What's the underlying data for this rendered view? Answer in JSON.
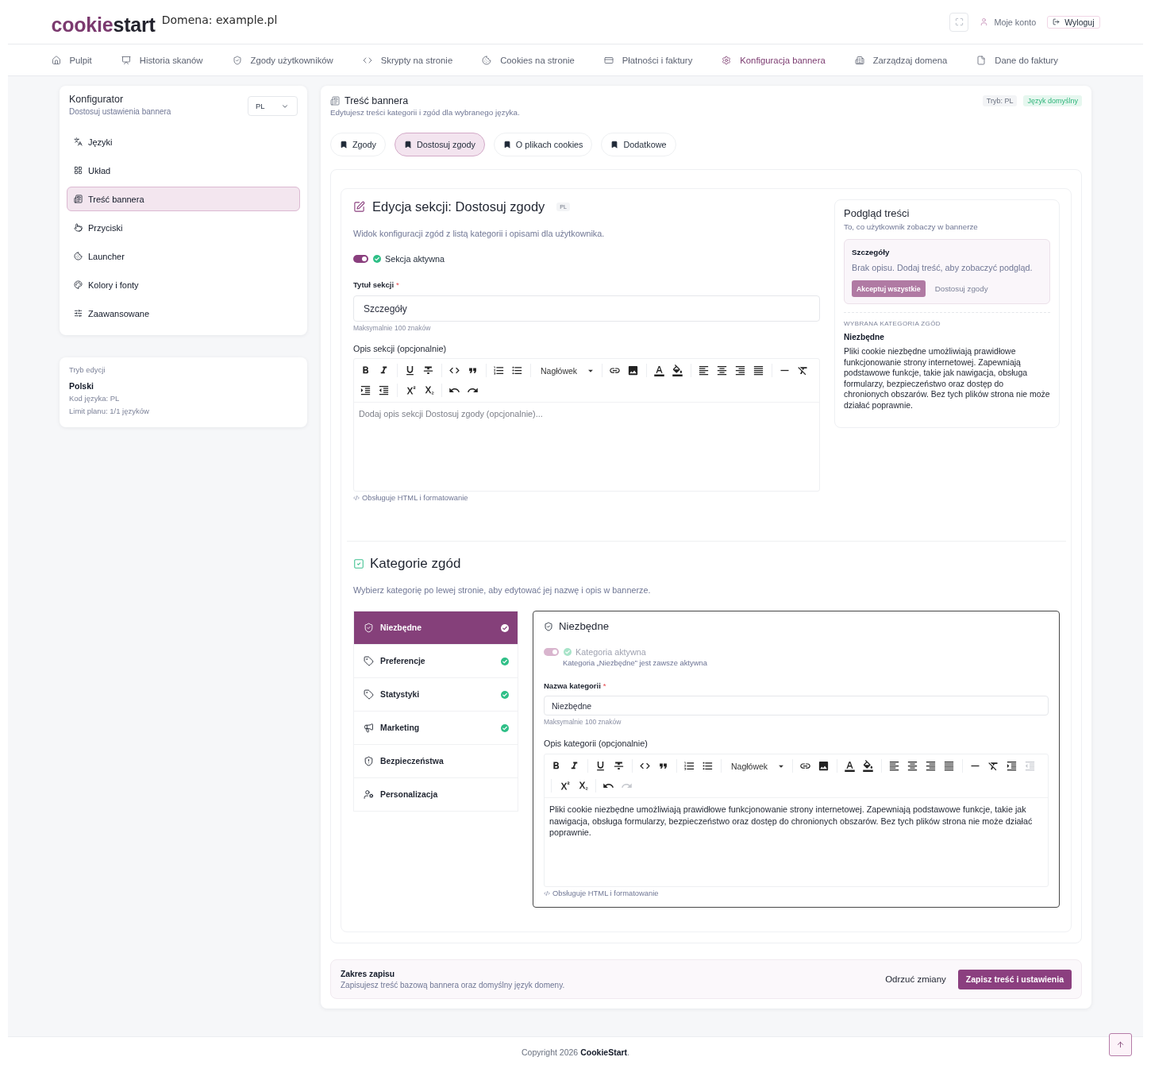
{
  "header": {
    "logo": {
      "brand": "cookie",
      "suffix": "start"
    },
    "domain": "Domena: example.pl",
    "account_link": "Moje konto",
    "logout_button": "Wyloguj"
  },
  "nav": [
    {
      "label": "Pulpit",
      "selected": false
    },
    {
      "label": "Historia skanów",
      "selected": false
    },
    {
      "label": "Zgody użytkowników",
      "selected": false
    },
    {
      "label": "Skrypty na stronie",
      "selected": false
    },
    {
      "label": "Cookies na stronie",
      "selected": false
    },
    {
      "label": "Płatności i faktury",
      "selected": false
    },
    {
      "label": "Konfiguracja bannera",
      "selected": true
    },
    {
      "label": "Zarządzaj domena",
      "selected": false
    },
    {
      "label": "Dane do faktury",
      "selected": false
    }
  ],
  "sidebar": {
    "title": "Konfigurator",
    "subtitle": "Dostosuj ustawienia bannera",
    "language_select": "PL",
    "items": [
      {
        "label": "Języki",
        "selected": false
      },
      {
        "label": "Układ",
        "selected": false
      },
      {
        "label": "Treść bannera",
        "selected": true
      },
      {
        "label": "Przyciski",
        "selected": false
      },
      {
        "label": "Launcher",
        "selected": false
      },
      {
        "label": "Kolory i fonty",
        "selected": false
      },
      {
        "label": "Zaawansowane",
        "selected": false
      }
    ]
  },
  "edit_mode": {
    "label": "Tryb edycji",
    "language": "Polski",
    "language_code": "Kod języka: PL",
    "plan_limit": "Limit planu: 1/1 języków"
  },
  "panel": {
    "title": "Treść bannera",
    "subtitle": "Edytujesz treści kategorii i zgód dla wybranego języka.",
    "badges": [
      {
        "label": "Tryb: PL",
        "kind": "neutral"
      },
      {
        "label": "Język domyślny",
        "kind": "success"
      }
    ],
    "tabs": [
      {
        "label": "Zgody",
        "selected": false
      },
      {
        "label": "Dostosuj zgody",
        "selected": true
      },
      {
        "label": "O plikach cookies",
        "selected": false
      },
      {
        "label": "Dodatkowe",
        "selected": false
      }
    ]
  },
  "section_editor": {
    "title": "Edycja sekcji: Dostosuj zgody",
    "language_badge": "PL",
    "description": "Widok konfiguracji zgód z listą kategorii i opisami dla użytkownika.",
    "active_toggle": {
      "label": "Sekcja aktywna",
      "on": true
    },
    "title_field": {
      "label": "Tytuł sekcji",
      "required_mark": "*",
      "value": "Szczegóły",
      "help": "Maksymalnie 100 znaków"
    },
    "description_field": {
      "label": "Opis sekcji (opcjonalnie)",
      "editor": {
        "heading_select": "Nagłówek",
        "outdent": {
          "disabled": false
        },
        "redo": {
          "disabled": false
        },
        "placeholder": "Dodaj opis sekcji Dostosuj zgody (opcjonalnie)..."
      },
      "note": "Obsługuje HTML i formatowanie"
    }
  },
  "preview": {
    "title": "Podgląd treści",
    "subtitle": "To, co użytkownik zobaczy w bannerze",
    "banner": {
      "title": "Szczegóły",
      "text": "Brak opisu. Dodaj treść, aby zobaczyć podgląd.",
      "accept_button": "Akceptuj wszystkie",
      "customize_button": "Dostosuj zgody"
    },
    "selected_category": {
      "heading": "WYBRANA KATEGORIA ZGÓD",
      "name": "Niezbędne",
      "description": "Pliki cookie niezbędne umożliwiają prawidłowe funkcjonowanie strony internetowej. Zapewniają podstawowe funkcje, takie jak nawigacja, obsługa formularzy, bezpieczeństwo oraz dostęp do chronionych obszarów. Bez tych plików strona nie może działać poprawnie."
    }
  },
  "categories": {
    "title": "Kategorie zgód",
    "subtitle": "Wybierz kategorię po lewej stronie, aby edytować jej nazwę i opis w bannerze.",
    "items": [
      {
        "label": "Niezbędne",
        "selected": true,
        "active": true
      },
      {
        "label": "Preferencje",
        "selected": false,
        "active": true
      },
      {
        "label": "Statystyki",
        "selected": false,
        "active": true
      },
      {
        "label": "Marketing",
        "selected": false,
        "active": true
      },
      {
        "label": "Bezpieczeństwa",
        "selected": false,
        "active": false
      },
      {
        "label": "Personalizacja",
        "selected": false,
        "active": false
      }
    ],
    "editor": {
      "title": "Niezbędne",
      "active_toggle": {
        "label": "Kategoria aktywna",
        "on": true,
        "disabled": true
      },
      "locked_note": "Kategoria „Niezbędne” jest zawsze aktywna",
      "name_field": {
        "label": "Nazwa kategorii",
        "required_mark": "*",
        "value": "Niezbędne",
        "help": "Maksymalnie 100 znaków"
      },
      "description_field": {
        "label": "Opis kategorii (opcjonalnie)",
        "editor": {
          "heading_select": "Nagłówek",
          "outdent": {
            "disabled": true
          },
          "redo": {
            "disabled": true
          },
          "value": "Pliki cookie niezbędne umożliwiają prawidłowe funkcjonowanie strony internetowej. Zapewniają podstawowe funkcje, takie jak nawigacja, obsługa formularzy, bezpieczeństwo oraz dostęp do chronionych obszarów. Bez tych plików strona nie może działać poprawnie."
        },
        "note": "Obsługuje HTML i formatowanie"
      }
    }
  },
  "save_bar": {
    "title": "Zakres zapisu",
    "description": "Zapisujesz treść bazową bannera oraz domyślny język domeny.",
    "discard_button": "Odrzuć zmiany",
    "save_button": "Zapisz treść i ustawienia"
  },
  "footer": {
    "copyright": "Copyright 2026 **CookieStart**."
  }
}
